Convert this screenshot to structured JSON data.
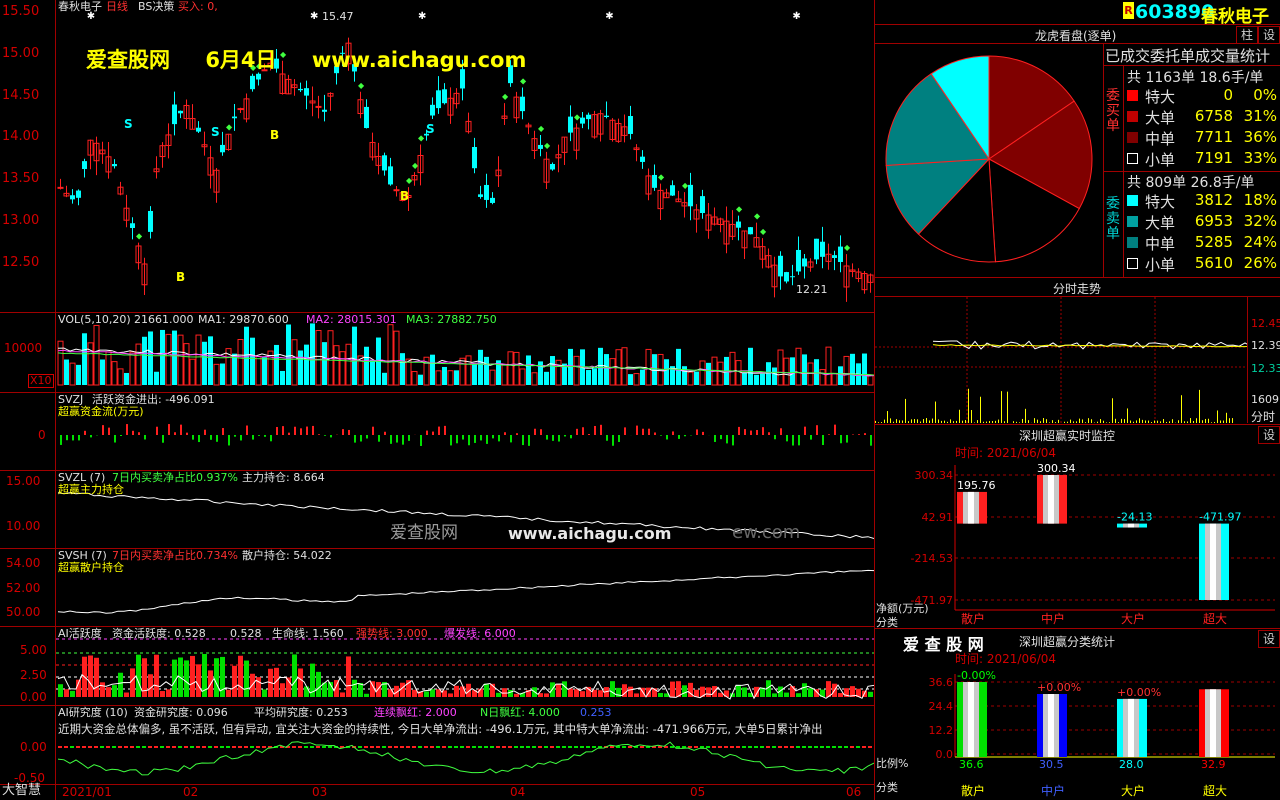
{
  "main_chart": {
    "title_left": "春秋电子",
    "title_period": "日线",
    "title_indicator": "BS决策",
    "title_buy": "买入: 0,",
    "y_ticks": [
      "15.50",
      "15.00",
      "14.50",
      "14.00",
      "13.50",
      "13.00",
      "12.50"
    ],
    "high_label": "15.47",
    "low_label": "12.21",
    "watermark_site": "爱查股网",
    "watermark_date": "6月4日",
    "watermark_url": "www.aichagu.com",
    "bs_marks": [
      "S",
      "S",
      "S",
      "B",
      "B",
      "B",
      "B"
    ]
  },
  "vol_panel": {
    "label": "VOL(5,10,20)",
    "value": "21661.000",
    "ma1": "MA1: 29870.600",
    "ma2": "MA2: 28015.301",
    "ma3": "MA3: 27882.750",
    "y_tick": "10000",
    "unit": "X10"
  },
  "svzj_panel": {
    "name": "SVZJ",
    "line1": "活跃资金进出: -496.091",
    "line2": "超赢资金流(万元)",
    "y_tick": "0"
  },
  "svzl_panel": {
    "name": "SVZL (7)",
    "ratio": "7日内买卖净占比0.937%",
    "hold": "主力持仓: 8.664",
    "line2": "超赢主力持仓",
    "y_ticks": [
      "15.00",
      "10.00"
    ],
    "watermark": "爱查股网",
    "watermark_url": "www.aichagu.com",
    "ghost_text": "ew.com"
  },
  "svsh_panel": {
    "name": "SVSH (7)",
    "ratio": "7日内买卖净占比0.734%",
    "hold": "散户持仓: 54.022",
    "line2": "超赢散户持仓",
    "y_ticks": [
      "54.00",
      "52.00",
      "50.00"
    ]
  },
  "ai_active_panel": {
    "name": "AI活跃度",
    "value": "资金活跃度: 0.528",
    "value2": "0.528",
    "life": "生命线: 1.560",
    "strong": "强势线: 3.000",
    "burst": "爆发线: 6.000",
    "y_ticks": [
      "5.00",
      "2.50",
      "0.00"
    ]
  },
  "ai_research_panel": {
    "name": "AI研究度 (10)",
    "value": "资金研究度: 0.096",
    "avg": "平均研究度: 0.253",
    "cont": "连续飘红: 2.000",
    "nday": "N日飘红: 4.000",
    "last": "0.253",
    "text": "近期大资金总体偏多, 虽不活跃, 但有异动, 宜关注大资金的持续性, 今日大单净流出: -496.1万元, 其中特大单净流出: -471.966万元, 大单5日累计净出",
    "y_ticks": [
      "0.00",
      "-0.50"
    ]
  },
  "x_axis": {
    "labels": [
      "2021/01",
      "02",
      "03",
      "04",
      "05",
      "06"
    ],
    "brand": "大智慧"
  },
  "right_header": {
    "badge": "R",
    "code": "603890",
    "name": "春秋电子",
    "btn1": "柱",
    "btn2": "设"
  },
  "dragon_tiger": {
    "title": "龙虎看盘(逐单)",
    "subtitle": "已成交委托单成交量统计",
    "buy_label": "委买单",
    "sell_label": "委卖单",
    "buy_total": "共 1163单 18.6手/单",
    "sell_total": "共 809单 26.8手/单",
    "buy_rows": [
      {
        "name": "特大",
        "value": "0",
        "pct": "0%",
        "color": "#ff0000"
      },
      {
        "name": "大单",
        "value": "6758",
        "pct": "31%",
        "color": "#c00000"
      },
      {
        "name": "中单",
        "value": "7711",
        "pct": "36%",
        "color": "#800000"
      },
      {
        "name": "小单",
        "value": "7191",
        "pct": "33%",
        "color": "#000000"
      }
    ],
    "sell_rows": [
      {
        "name": "特大",
        "value": "3812",
        "pct": "18%",
        "color": "#00ffff"
      },
      {
        "name": "大单",
        "value": "6953",
        "pct": "32%",
        "color": "#00a0a0"
      },
      {
        "name": "中单",
        "value": "5285",
        "pct": "24%",
        "color": "#008080"
      },
      {
        "name": "小单",
        "value": "5610",
        "pct": "26%",
        "color": "#000000"
      }
    ],
    "pie_slices": [
      {
        "name": "买特大",
        "pct": 0,
        "color": "#ff0000"
      },
      {
        "name": "买大单",
        "pct": 15.5,
        "color": "#800000"
      },
      {
        "name": "买中单",
        "pct": 17.5,
        "color": "#800000"
      },
      {
        "name": "买小单",
        "pct": 16,
        "color": "#000000"
      },
      {
        "name": "卖小单",
        "pct": 13,
        "color": "#000000"
      },
      {
        "name": "卖中单",
        "pct": 12,
        "color": "#008080"
      },
      {
        "name": "卖大单",
        "pct": 16.5,
        "color": "#008080"
      },
      {
        "name": "卖特大",
        "pct": 9.5,
        "color": "#00ffff"
      }
    ]
  },
  "intraday": {
    "title": "分时走势",
    "y_ticks": [
      "12.45",
      "12.39",
      "12.33"
    ],
    "vol_tick": "1609",
    "vol_label": "分时"
  },
  "realtime_monitor": {
    "title": "深圳超赢实时监控",
    "btn": "设",
    "time": "时间: 2021/06/04",
    "y_ticks": [
      "300.34",
      "42.91",
      "-214.53",
      "-471.97"
    ],
    "y_label": "净额(万元)",
    "x_label": "分类",
    "bars": [
      {
        "name": "散户",
        "value": "195.76"
      },
      {
        "name": "中户",
        "value": "300.34"
      },
      {
        "name": "大户",
        "value": "-24.13"
      },
      {
        "name": "超大",
        "value": "-471.97"
      }
    ]
  },
  "class_stats": {
    "brand": "爱 查 股 网",
    "title": "深圳超赢分类统计",
    "btn": "设",
    "time": "时间: 2021/06/04",
    "y_ticks": [
      "36.6",
      "24.4",
      "12.2",
      "0.0"
    ],
    "y_label": "比例%",
    "x_label": "分类",
    "bars": [
      {
        "name": "散户",
        "value": "36.6",
        "delta": "-0.00%",
        "color": "#00e000"
      },
      {
        "name": "中户",
        "value": "30.5",
        "delta": "+0.00%",
        "color": "#0000ff"
      },
      {
        "name": "大户",
        "value": "28.0",
        "delta": "+0.00%",
        "color": "#00ffff"
      },
      {
        "name": "超大",
        "value": "32.9",
        "delta": "",
        "color": "#ff0000"
      }
    ]
  }
}
